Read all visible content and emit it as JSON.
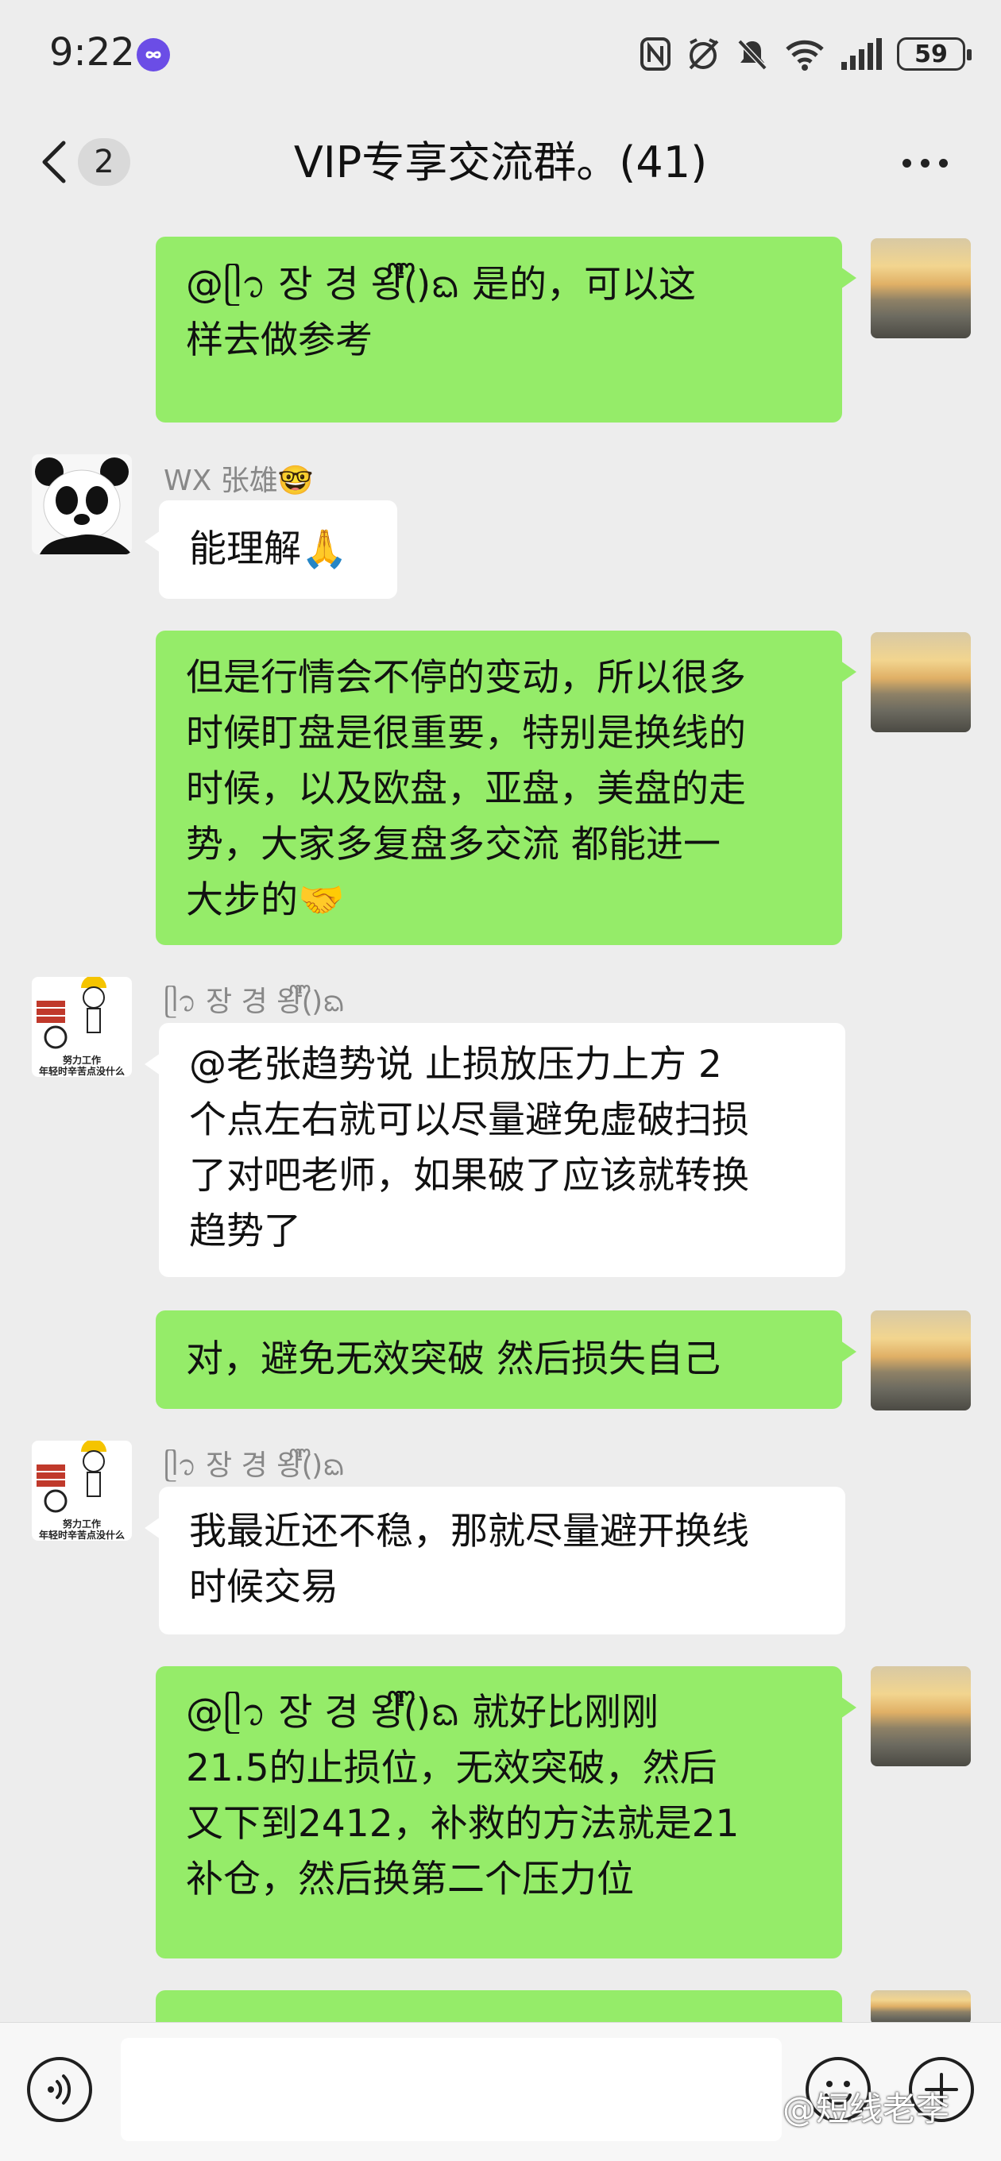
{
  "status_bar": {
    "time": "9:22",
    "battery": "59"
  },
  "nav": {
    "back_count": "2",
    "title": "VIP专享交流群。(41)"
  },
  "messages": [
    {
      "side": "right",
      "text": "@ᥫ᭡ 장 경 왕ᩚ(ᩚ)ᨳ 是的，可以这\n样去做参考"
    },
    {
      "side": "left",
      "sender": "WX 张雄🤓",
      "text": "能理解🙏"
    },
    {
      "side": "right",
      "text": "但是行情会不停的变动，所以很多\n时候盯盘是很重要，特别是换线的\n时候，以及欧盘，亚盘，美盘的走\n势，大家多复盘多交流 都能进一\n大步的🤝"
    },
    {
      "side": "left",
      "sender": "ᥫ᭡ 장 경 왕ᩚ(ᩚ)ᨳ",
      "text": "@老张趋势说  止损放压力上方 2\n个点左右就可以尽量避免虚破扫损\n了对吧老师，如果破了应该就转换\n趋势了"
    },
    {
      "side": "right",
      "text": "对，避免无效突破 然后损失自己"
    },
    {
      "side": "left",
      "sender": "ᥫ᭡ 장 경 왕ᩚ(ᩚ)ᨳ",
      "text": "我最近还不稳，那就尽量避开换线\n时候交易"
    },
    {
      "side": "right",
      "text": "@ᥫ᭡ 장 경 왕ᩚ(ᩚ)ᨳ 就好比刚刚\n21.5的止损位，无效突破，然后\n又下到2412，补救的方法就是21\n补仓，然后换第二个压力位"
    }
  ],
  "avatars": {
    "worker_caption_1": "努力工作",
    "worker_caption_2": "年轻时辛苦点没什么"
  },
  "input": {
    "placeholder": ""
  },
  "watermark": "@短线老李",
  "colors": {
    "green_bubble": "#95ec69",
    "background": "#ededed",
    "white_bubble": "#ffffff"
  }
}
